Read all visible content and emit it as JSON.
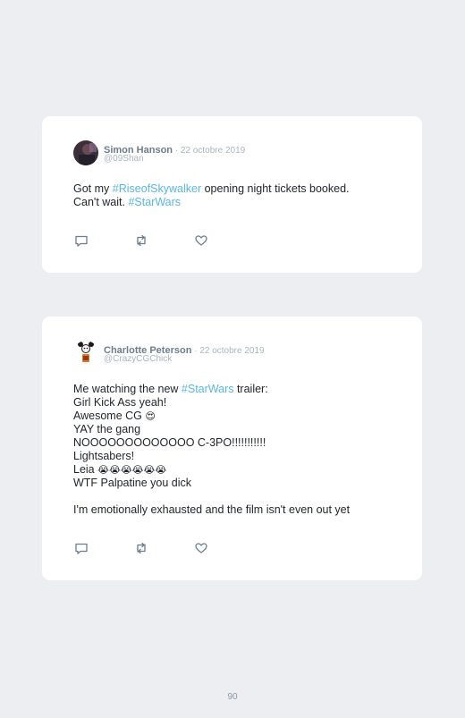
{
  "tweets": [
    {
      "author_name": "Simon Hanson",
      "separator": " · ",
      "date": "22 octobre 2019",
      "handle": "@09Shan",
      "line1": {
        "before": "Got my ",
        "hashtag": "#RiseofSkywalker",
        "after": " opening night tickets booked."
      },
      "line2": {
        "before": "Can't wait. ",
        "hashtag": "#StarWars"
      },
      "actions": [
        "reply-icon",
        "retweet-icon",
        "like-icon"
      ]
    },
    {
      "author_name": "Charlotte Peterson",
      "separator": " · ",
      "date": "22 octobre 2019",
      "handle": "@CrazyCGChick",
      "line1": {
        "before": "Me watching the new ",
        "hashtag": "#StarWars",
        "after": " trailer:"
      },
      "line2": "Girl Kick Ass yeah!",
      "line3": {
        "text": "Awesome CG ",
        "emoji": "😍"
      },
      "line4": "YAY the gang",
      "line5": "NOOOOOOOOOOOOO C-3PO!!!!!!!!!!!",
      "line6": "Lightsabers!",
      "line7": {
        "text": "Leia ",
        "emoji": "😭😭😭😭😭😭"
      },
      "line8": "WTF Palpatine you dick",
      "line9": "I'm emotionally exhausted and the film isn't even out yet",
      "actions": [
        "reply-icon",
        "retweet-icon",
        "like-icon"
      ]
    }
  ],
  "page_number": "90",
  "colors": {
    "background": "#eceef2",
    "card": "#ffffff",
    "hashtag": "#5cb6e2",
    "name": "#6e7d8e",
    "muted": "#aab4bf",
    "icon": "#6e7d8e"
  }
}
